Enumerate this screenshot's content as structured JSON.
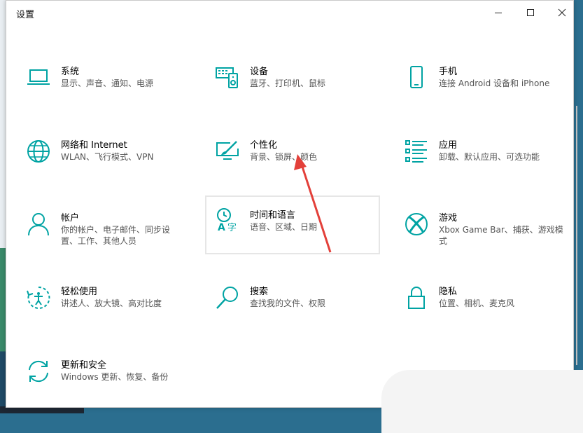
{
  "window": {
    "title": "设置"
  },
  "accent_color": "#00a3a3",
  "tiles": [
    {
      "id": "system",
      "icon": "laptop-icon",
      "name": "系统",
      "desc": "显示、声音、通知、电源"
    },
    {
      "id": "devices",
      "icon": "keyboard-speaker-icon",
      "name": "设备",
      "desc": "蓝牙、打印机、鼠标"
    },
    {
      "id": "phone",
      "icon": "phone-icon",
      "name": "手机",
      "desc": "连接 Android 设备和 iPhone"
    },
    {
      "id": "network",
      "icon": "globe-icon",
      "name": "网络和 Internet",
      "desc": "WLAN、飞行模式、VPN"
    },
    {
      "id": "personalization",
      "icon": "paint-monitor-icon",
      "name": "个性化",
      "desc": "背景、锁屏、颜色"
    },
    {
      "id": "apps",
      "icon": "app-list-icon",
      "name": "应用",
      "desc": "卸载、默认应用、可选功能"
    },
    {
      "id": "accounts",
      "icon": "person-icon",
      "name": "帐户",
      "desc": "你的帐户、电子邮件、同步设置、工作、其他人员"
    },
    {
      "id": "time-language",
      "icon": "clock-language-icon",
      "name": "时间和语言",
      "desc": "语音、区域、日期"
    },
    {
      "id": "gaming",
      "icon": "xbox-icon",
      "name": "游戏",
      "desc": "Xbox Game Bar、捕获、游戏模式"
    },
    {
      "id": "ease-of-access",
      "icon": "ease-access-icon",
      "name": "轻松使用",
      "desc": "讲述人、放大镜、高对比度"
    },
    {
      "id": "search",
      "icon": "magnifier-icon",
      "name": "搜索",
      "desc": "查找我的文件、权限"
    },
    {
      "id": "privacy",
      "icon": "lock-icon",
      "name": "隐私",
      "desc": "位置、相机、麦克风"
    },
    {
      "id": "update-security",
      "icon": "sync-arrows-icon",
      "name": "更新和安全",
      "desc": "Windows 更新、恢复、备份"
    }
  ]
}
